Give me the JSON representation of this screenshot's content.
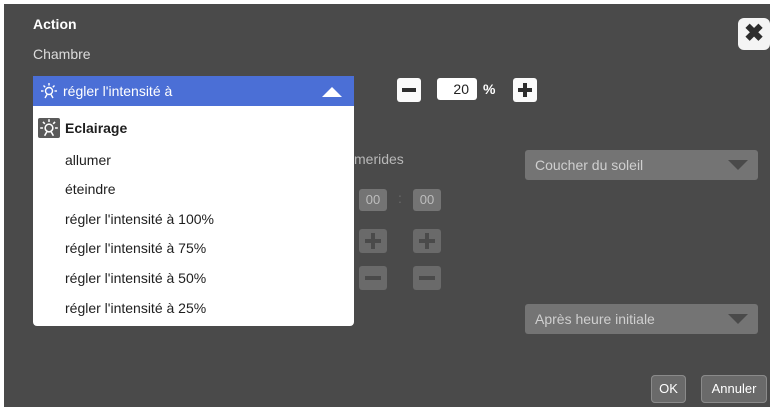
{
  "dialog": {
    "title": "Action",
    "room": "Chambre"
  },
  "dropdown": {
    "selected": "régler l'intensité à",
    "group_label": "Eclairage",
    "options": [
      "allumer",
      "éteindre",
      "régler l'intensité à 100%",
      "régler l'intensité à 75%",
      "régler l'intensité à 50%",
      "régler l'intensité à 25%"
    ]
  },
  "intensity": {
    "value": "20",
    "unit": "%"
  },
  "ephemerides": {
    "label_visible": "merides"
  },
  "time": {
    "hours": "00",
    "minutes": "00",
    "separator": ":"
  },
  "selects": {
    "sun_event": "Coucher du soleil",
    "offset_mode": "Après heure initiale"
  },
  "buttons": {
    "ok": "OK",
    "cancel": "Annuler",
    "close": "✖"
  },
  "colors": {
    "dialog_bg": "#4a4a4a",
    "accent": "#4b6fd6"
  }
}
